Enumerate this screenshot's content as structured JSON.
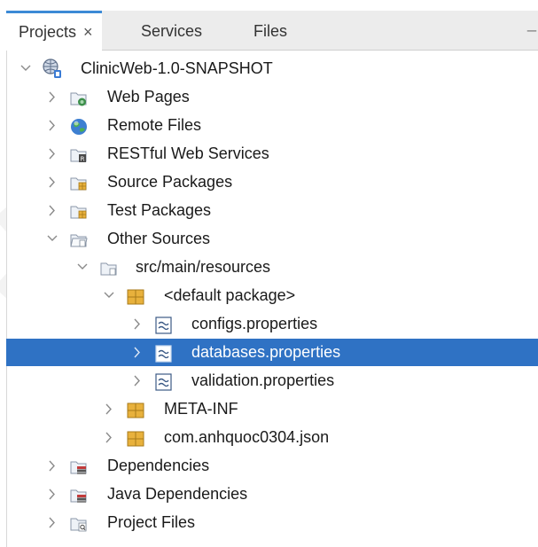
{
  "tabs": [
    {
      "label": "Projects",
      "close": "×",
      "active": true
    },
    {
      "label": "Services",
      "active": false
    },
    {
      "label": "Files",
      "active": false
    }
  ],
  "minimize_glyph": "_",
  "tree": [
    {
      "label": "ClinicWeb-1.0-SNAPSHOT",
      "icon": "globe-project-icon",
      "expanded": true
    },
    {
      "label": "Web Pages",
      "icon": "web-pages-folder-icon",
      "expanded": false
    },
    {
      "label": "Remote Files",
      "icon": "remote-globe-icon",
      "expanded": false
    },
    {
      "label": "RESTful Web Services",
      "icon": "rest-services-folder-icon",
      "expanded": false
    },
    {
      "label": "Source Packages",
      "icon": "source-packages-folder-icon",
      "expanded": false
    },
    {
      "label": "Test Packages",
      "icon": "test-packages-folder-icon",
      "expanded": false
    },
    {
      "label": "Other Sources",
      "icon": "other-sources-folder-icon",
      "expanded": true
    },
    {
      "label": "src/main/resources",
      "icon": "resources-folder-icon",
      "expanded": true
    },
    {
      "label": "<default package>",
      "icon": "package-icon",
      "expanded": true
    },
    {
      "label": "configs.properties",
      "icon": "properties-file-icon",
      "expanded": false
    },
    {
      "label": "databases.properties",
      "icon": "properties-file-icon",
      "expanded": false,
      "selected": true
    },
    {
      "label": "validation.properties",
      "icon": "properties-file-icon",
      "expanded": false
    },
    {
      "label": "META-INF",
      "icon": "package-icon",
      "expanded": false
    },
    {
      "label": "com.anhquoc0304.json",
      "icon": "package-icon",
      "expanded": false
    },
    {
      "label": "Dependencies",
      "icon": "dependencies-folder-icon",
      "expanded": false
    },
    {
      "label": "Java Dependencies",
      "icon": "java-dependencies-folder-icon",
      "expanded": false
    },
    {
      "label": "Project Files",
      "icon": "project-files-folder-icon",
      "expanded": false
    }
  ],
  "colors": {
    "selection": "#2f72c4",
    "tab_accent": "#3c8ad6",
    "folder": "#e8eef5",
    "package": "#e8b13c"
  }
}
